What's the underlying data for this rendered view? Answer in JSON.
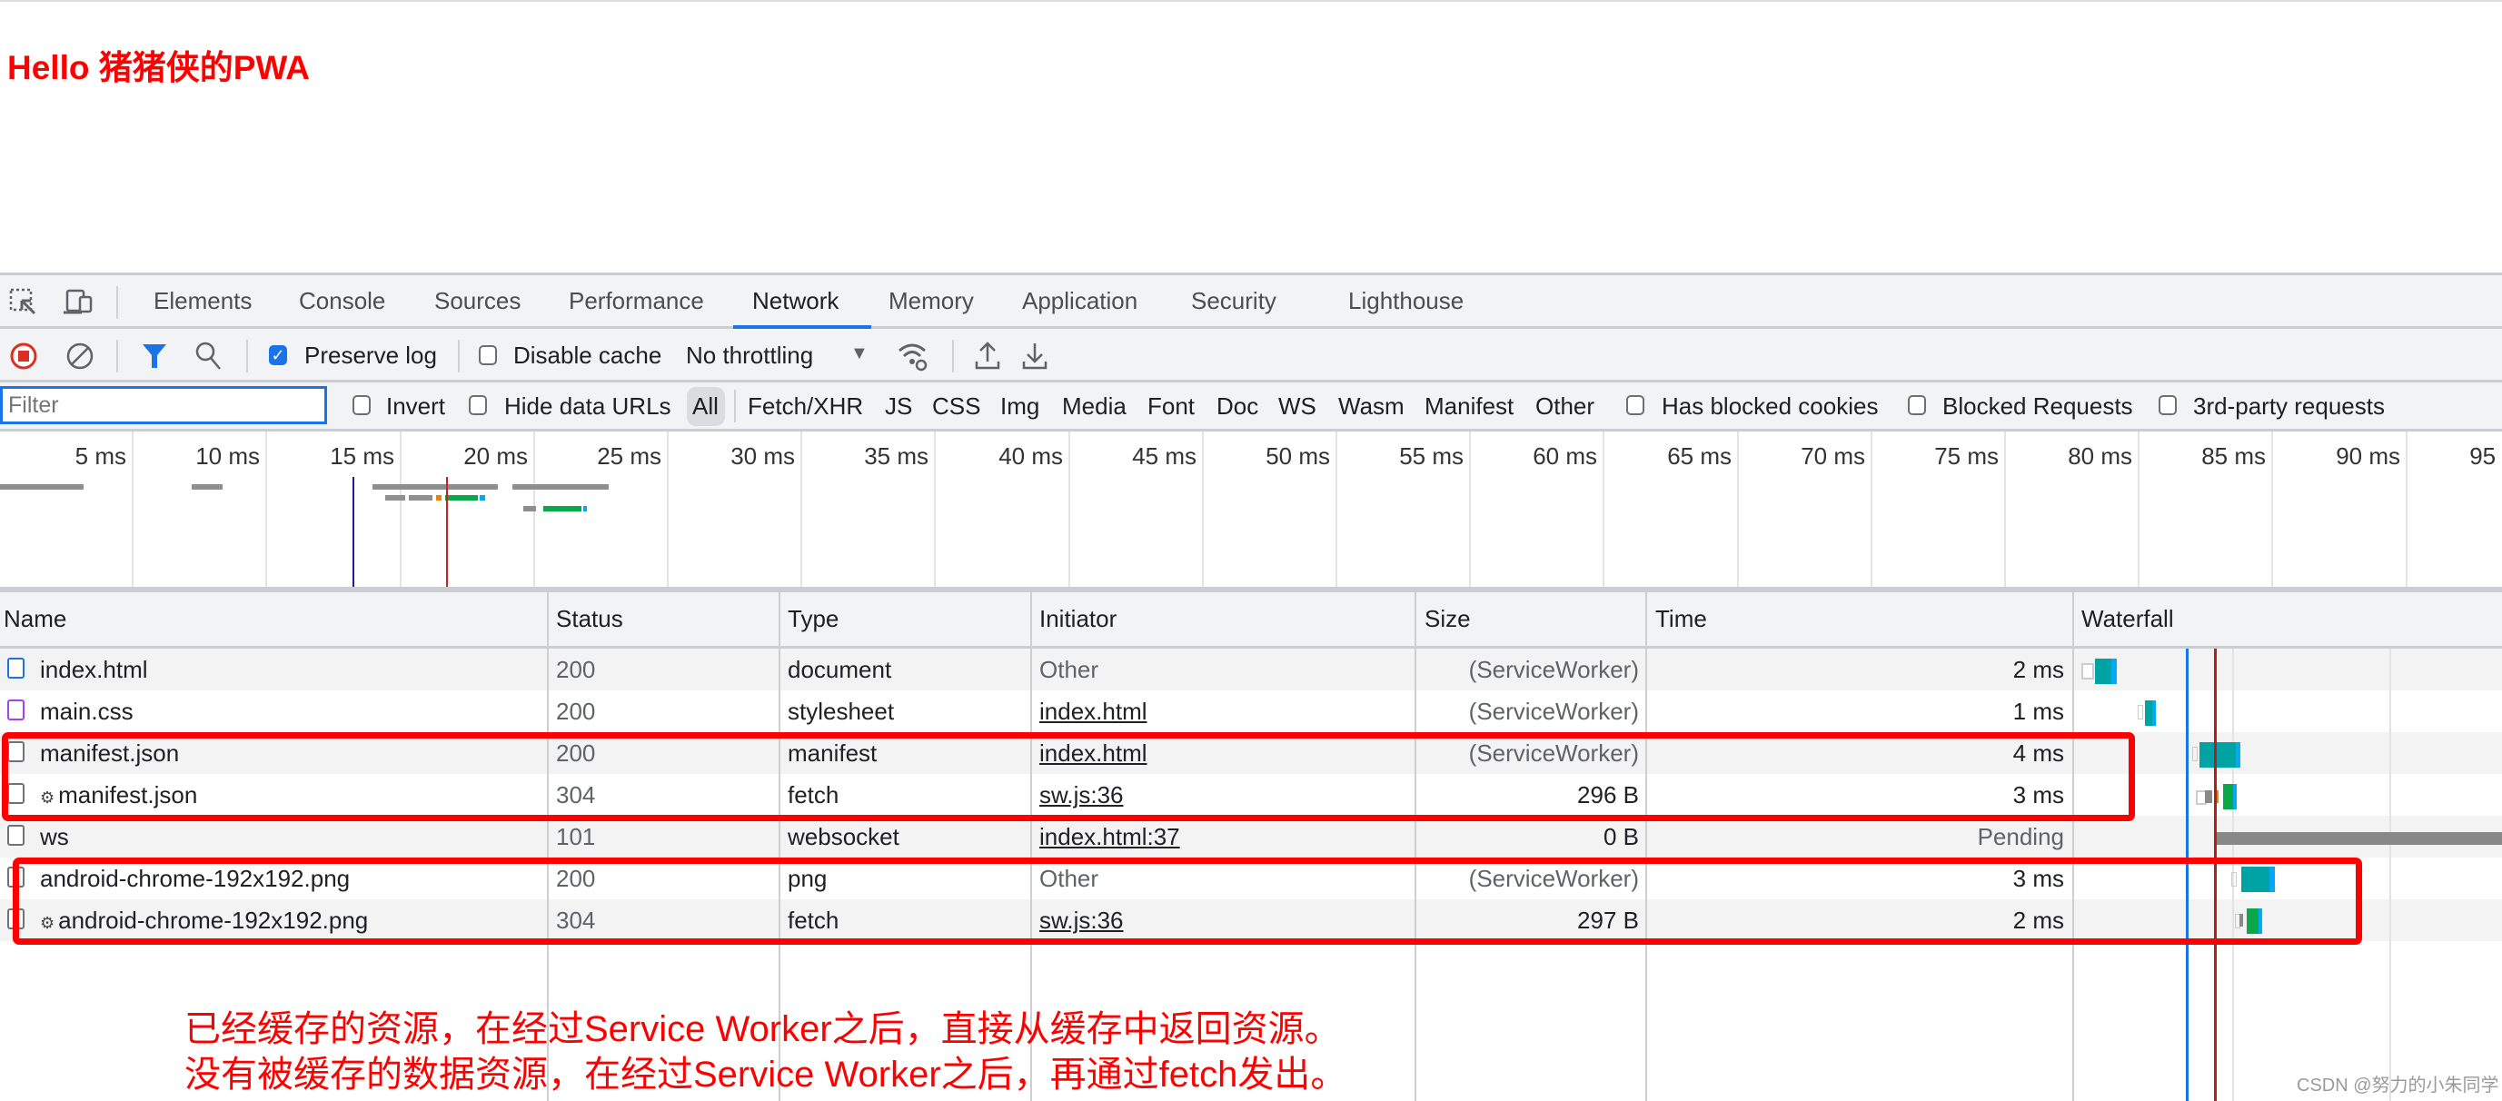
{
  "page": {
    "heading": "Hello 猪猪侠的PWA"
  },
  "devtools": {
    "tabs": [
      {
        "label": "Elements",
        "active": false
      },
      {
        "label": "Console",
        "active": false
      },
      {
        "label": "Sources",
        "active": false
      },
      {
        "label": "Performance",
        "active": false
      },
      {
        "label": "Network",
        "active": true
      },
      {
        "label": "Memory",
        "active": false
      },
      {
        "label": "Application",
        "active": false
      },
      {
        "label": "Security",
        "active": false
      },
      {
        "label": "Lighthouse",
        "active": false
      }
    ],
    "toolbar": {
      "preserve_log": {
        "label": "Preserve log",
        "checked": true
      },
      "disable_cache": {
        "label": "Disable cache",
        "checked": false
      },
      "throttling": "No throttling",
      "icons": [
        "inspect-icon",
        "device-toolbar-icon",
        "record-stop-icon",
        "clear-icon",
        "filter-icon",
        "search-icon",
        "network-conditions-icon",
        "import-har-icon",
        "export-har-icon"
      ]
    },
    "filterbar": {
      "filter_placeholder": "Filter",
      "invert": {
        "label": "Invert",
        "checked": false
      },
      "hide_data_urls": {
        "label": "Hide data URLs",
        "checked": false
      },
      "types": [
        "All",
        "Fetch/XHR",
        "JS",
        "CSS",
        "Img",
        "Media",
        "Font",
        "Doc",
        "WS",
        "Wasm",
        "Manifest",
        "Other"
      ],
      "selected_type": "All",
      "has_blocked_cookies": {
        "label": "Has blocked cookies",
        "checked": false
      },
      "blocked_requests": {
        "label": "Blocked Requests",
        "checked": false
      },
      "third_party": {
        "label": "3rd-party requests",
        "checked": false
      }
    },
    "overview": {
      "ticks": [
        "5 ms",
        "10 ms",
        "15 ms",
        "20 ms",
        "25 ms",
        "30 ms",
        "35 ms",
        "40 ms",
        "45 ms",
        "50 ms",
        "55 ms",
        "60 ms",
        "65 ms",
        "70 ms",
        "75 ms",
        "80 ms",
        "85 ms",
        "90 ms",
        "95 ms"
      ],
      "dom_content_loaded_ms": 13.3,
      "load_ms": 16.8
    },
    "table": {
      "columns": [
        "Name",
        "Status",
        "Type",
        "Initiator",
        "Size",
        "Time",
        "Waterfall"
      ],
      "rows": [
        {
          "name": "index.html",
          "icon": "document-icon",
          "sw_gear": false,
          "status": "200",
          "type": "document",
          "initiator": "Other",
          "initiator_link": false,
          "size": "(ServiceWorker)",
          "time": "2 ms"
        },
        {
          "name": "main.css",
          "icon": "stylesheet-icon",
          "sw_gear": false,
          "status": "200",
          "type": "stylesheet",
          "initiator": "index.html",
          "initiator_link": true,
          "size": "(ServiceWorker)",
          "time": "1 ms"
        },
        {
          "name": "manifest.json",
          "icon": "file-icon",
          "sw_gear": false,
          "status": "200",
          "type": "manifest",
          "initiator": "index.html",
          "initiator_link": true,
          "size": "(ServiceWorker)",
          "time": "4 ms"
        },
        {
          "name": "manifest.json",
          "icon": "file-icon",
          "sw_gear": true,
          "status": "304",
          "type": "fetch",
          "initiator": "sw.js:36",
          "initiator_link": true,
          "size": "296 B",
          "time": "3 ms"
        },
        {
          "name": "ws",
          "icon": "file-icon",
          "sw_gear": false,
          "status": "101",
          "type": "websocket",
          "initiator": "index.html:37",
          "initiator_link": true,
          "size": "0 B",
          "time": "Pending"
        },
        {
          "name": "android-chrome-192x192.png",
          "icon": "file-icon",
          "sw_gear": false,
          "status": "200",
          "type": "png",
          "initiator": "Other",
          "initiator_link": false,
          "size": "(ServiceWorker)",
          "time": "3 ms"
        },
        {
          "name": "android-chrome-192x192.png",
          "icon": "file-icon",
          "sw_gear": true,
          "status": "304",
          "type": "fetch",
          "initiator": "sw.js:36",
          "initiator_link": true,
          "size": "297 B",
          "time": "2 ms"
        }
      ]
    }
  },
  "annotations": {
    "line1": "已经缓存的资源，在经过Service Worker之后，直接从缓存中返回资源。",
    "line2": "没有被缓存的数据资源，在经过Service Worker之后，再通过fetch发出。"
  },
  "watermark": "CSDN @努力的小朱同学",
  "colors": {
    "accent": "#1a73e8",
    "annotation": "#ff0000",
    "waiting": "#00a3a3",
    "download": "#0aa84a",
    "receive": "#03a9f4"
  }
}
